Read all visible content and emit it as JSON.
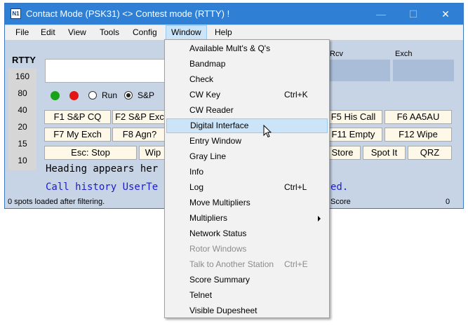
{
  "window": {
    "icon_label": "N1",
    "title": "Contact Mode (PSK31) <> Contest mode (RTTY) !",
    "minimize_glyph": "—",
    "maximize_glyph": "☐",
    "close_glyph": "✕"
  },
  "menubar": {
    "items": [
      "File",
      "Edit",
      "View",
      "Tools",
      "Config",
      "Window",
      "Help"
    ],
    "active": "Window"
  },
  "mode_label": "RTTY",
  "bands": [
    "160",
    "80",
    "40",
    "20",
    "15",
    "10"
  ],
  "fields": {
    "rcv_label": "Rcv",
    "exch_label": "Exch"
  },
  "radios": {
    "run_label": "Run",
    "sp_label": "S&P",
    "selected": "S&P"
  },
  "function_keys": {
    "f1": "F1 S&P CQ",
    "f2": "F2 S&P Exc",
    "f5": "F5 His Call",
    "f6": "F6 AA5AU",
    "f7": "F7 My Exch",
    "f8": "F8 Agn?",
    "f11": "F11 Empty",
    "f12": "F12 Wipe"
  },
  "action_buttons": {
    "esc": "Esc: Stop",
    "wipe": "Wip",
    "store": "Store",
    "spot": "Spot It",
    "qrz": "QRZ"
  },
  "info_lines": {
    "heading": "Heading appears her",
    "call_history_left": "Call history UserTe",
    "call_history_right": "ed."
  },
  "status": {
    "spots": "0 spots loaded after filtering.",
    "score_label": "Score",
    "score_value": "0"
  },
  "window_menu": {
    "items": [
      {
        "label": "Available Mult's & Q's",
        "shortcut": "",
        "disabled": false,
        "submenu": false
      },
      {
        "label": "Bandmap",
        "shortcut": "",
        "disabled": false,
        "submenu": false
      },
      {
        "label": "Check",
        "shortcut": "",
        "disabled": false,
        "submenu": false
      },
      {
        "label": "CW Key",
        "shortcut": "Ctrl+K",
        "disabled": false,
        "submenu": false
      },
      {
        "label": "CW Reader",
        "shortcut": "",
        "disabled": false,
        "submenu": false
      },
      {
        "label": "Digital Interface",
        "shortcut": "",
        "disabled": false,
        "submenu": false
      },
      {
        "label": "Entry Window",
        "shortcut": "",
        "disabled": false,
        "submenu": false
      },
      {
        "label": "Gray Line",
        "shortcut": "",
        "disabled": false,
        "submenu": false
      },
      {
        "label": "Info",
        "shortcut": "",
        "disabled": false,
        "submenu": false
      },
      {
        "label": "Log",
        "shortcut": "Ctrl+L",
        "disabled": false,
        "submenu": false
      },
      {
        "label": "Move Multipliers",
        "shortcut": "",
        "disabled": false,
        "submenu": false
      },
      {
        "label": "Multipliers",
        "shortcut": "",
        "disabled": false,
        "submenu": true
      },
      {
        "label": "Network Status",
        "shortcut": "",
        "disabled": false,
        "submenu": false
      },
      {
        "label": "Rotor Windows",
        "shortcut": "",
        "disabled": true,
        "submenu": false
      },
      {
        "label": "Talk to Another Station",
        "shortcut": "Ctrl+E",
        "disabled": true,
        "submenu": false
      },
      {
        "label": "Score Summary",
        "shortcut": "",
        "disabled": false,
        "submenu": false
      },
      {
        "label": "Telnet",
        "shortcut": "",
        "disabled": false,
        "submenu": false
      },
      {
        "label": "Visible Dupesheet",
        "shortcut": "",
        "disabled": false,
        "submenu": false
      }
    ],
    "highlighted": "Digital Interface"
  },
  "colors": {
    "titlebar": "#2f7fd4",
    "window_bg": "#c7d4e6",
    "button_bg": "#fdf8e8",
    "led_green": "#1aa31a",
    "led_red": "#e31414",
    "heading_text": "#000000",
    "call_history_text": "#1c1cd0",
    "menu_highlight": "#cce4f7"
  }
}
